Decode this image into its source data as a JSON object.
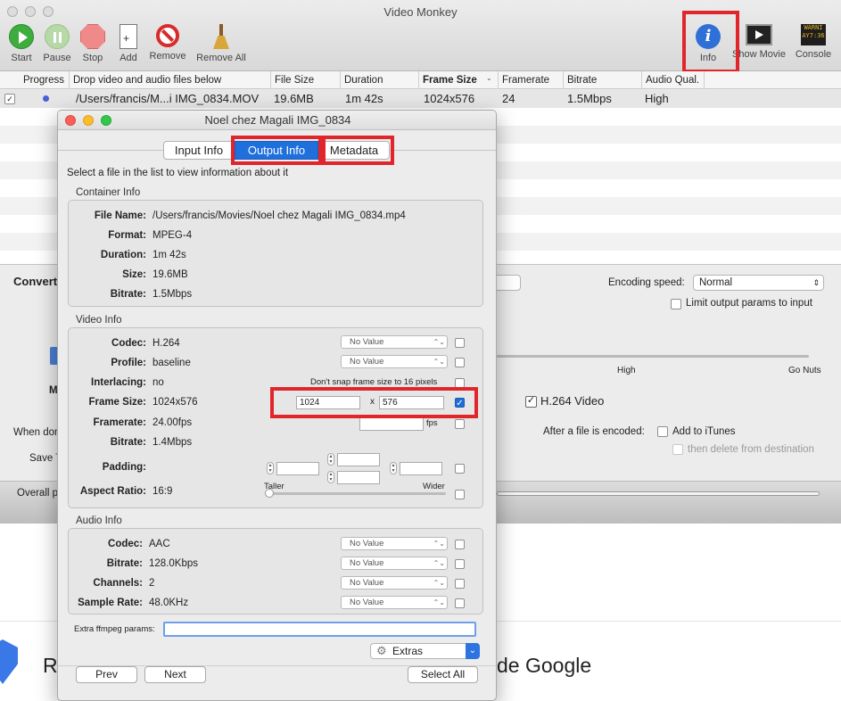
{
  "main_window": {
    "title": "Video Monkey",
    "toolbar": {
      "start": "Start",
      "pause": "Pause",
      "stop": "Stop",
      "add": "Add",
      "remove": "Remove",
      "remove_all": "Remove All",
      "info": "Info",
      "show_movie": "Show Movie",
      "console": "Console"
    },
    "columns": [
      "Progress",
      "Drop video and audio files below",
      "File Size",
      "Duration",
      "Frame Size",
      "Framerate",
      "Bitrate",
      "Audio Qual."
    ],
    "row": {
      "file": "/Users/francis/M...i IMG_0834.MOV",
      "size": "19.6MB",
      "duration": "1m 42s",
      "frame_size": "1024x576",
      "framerate": "24",
      "bitrate": "1.5Mbps",
      "audio": "High"
    },
    "convert_label": "Convert",
    "encoding_speed_label": "Encoding speed:",
    "encoding_speed_value": "Normal",
    "limit_label": "Limit output params to input",
    "slider_high": "High",
    "slider_gonuts": "Go Nuts",
    "h264_label": "H.264 Video",
    "when_done": "When don",
    "save_label": "Save T",
    "after_encoded_label": "After a file is encoded:",
    "add_itunes": "Add to iTunes",
    "then_delete": "then delete from destination",
    "overall_label": "Overall p",
    "m_label": "M",
    "bg_text_left": "R",
    "bg_text_right": "de Google"
  },
  "panel": {
    "title": "Noel chez Magali IMG_0834",
    "tabs": [
      "Input Info",
      "Output Info",
      "Metadata"
    ],
    "hint": "Select a file in the list to view information about it",
    "container": {
      "heading": "Container Info",
      "file_name_label": "File Name:",
      "file_name": "/Users/francis/Movies/Noel chez Magali IMG_0834.mp4",
      "format_label": "Format:",
      "format": "MPEG-4",
      "duration_label": "Duration:",
      "duration": "1m 42s",
      "size_label": "Size:",
      "size": "19.6MB",
      "bitrate_label": "Bitrate:",
      "bitrate": "1.5Mbps"
    },
    "video": {
      "heading": "Video Info",
      "codec_label": "Codec:",
      "codec": "H.264",
      "profile_label": "Profile:",
      "profile": "baseline",
      "interlacing_label": "Interlacing:",
      "interlacing": "no",
      "snap_label": "Don't snap frame size to 16 pixels",
      "frame_label": "Frame Size:",
      "frame": "1024x576",
      "frame_w": "1024",
      "frame_x": "x",
      "frame_h": "576",
      "framerate_label": "Framerate:",
      "framerate": "24.00fps",
      "fps": "fps",
      "bitrate_label": "Bitrate:",
      "bitrate": "1.4Mbps",
      "padding_label": "Padding:",
      "aspect_label": "Aspect Ratio:",
      "aspect": "16:9",
      "taller": "Taller",
      "wider": "Wider",
      "no_value": "No Value"
    },
    "audio": {
      "heading": "Audio Info",
      "codec_label": "Codec:",
      "codec": "AAC",
      "bitrate_label": "Bitrate:",
      "bitrate": "128.0Kbps",
      "channels_label": "Channels:",
      "channels": "2",
      "samplerate_label": "Sample Rate:",
      "samplerate": "48.0KHz",
      "no_value": "No Value"
    },
    "extra_label": "Extra ffmpeg params:",
    "extras_button": "Extras",
    "prev": "Prev",
    "next": "Next",
    "select_all": "Select All"
  },
  "colors": {
    "highlight": "#e0262b",
    "accent": "#1f6fdc"
  }
}
